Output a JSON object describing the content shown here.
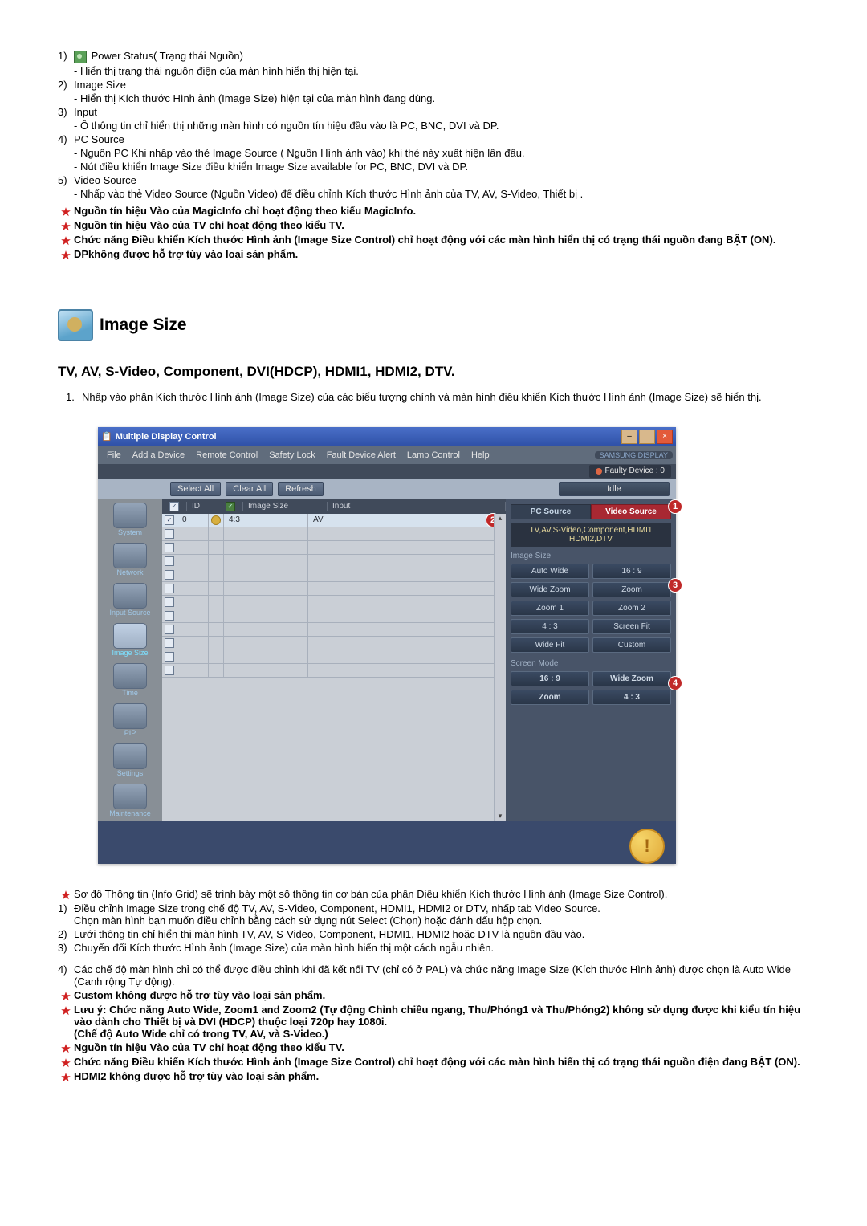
{
  "top_list": {
    "1": {
      "title": "Power Status( Trạng thái Nguồn)",
      "sub": [
        "Hiển thị trạng thái nguồn điện của màn hình hiển thị hiện tại."
      ]
    },
    "2": {
      "title": "Image Size",
      "sub": [
        "Hiển thị Kích thước Hình ảnh (Image Size) hiện tại của màn hình đang dùng."
      ]
    },
    "3": {
      "title": "Input",
      "sub": [
        "Ô thông tin chỉ hiển thị những màn hình có nguồn tín hiệu đầu vào là PC, BNC, DVI và DP."
      ]
    },
    "4": {
      "title": "PC Source",
      "sub": [
        "Nguồn PC Khi nhấp vào thẻ Image Source ( Nguồn Hình ảnh vào) khi thẻ này xuất hiện lần đầu.",
        "Nút điều khiển Image Size điều khiển Image Size available for PC, BNC, DVI và DP."
      ]
    },
    "5": {
      "title": "Video Source",
      "sub": [
        "Nhấp vào thẻ Video Source (Nguồn Video) để điều chỉnh Kích thước Hình ảnh của TV, AV, S-Video, Thiết bị ."
      ]
    }
  },
  "top_notes": [
    "Nguồn tín hiệu Vào của MagicInfo chỉ hoạt động theo kiểu MagicInfo.",
    "Nguồn tín hiệu Vào của TV chỉ hoạt động theo kiểu TV.",
    "Chức năng Điều khiển Kích thước Hình ảnh (Image Size Control) chỉ hoạt động với các màn hình hiển thị có trạng thái nguồn đang BẬT (ON).",
    "DPkhông được hỗ trợ tùy vào loại sản phẩm."
  ],
  "section": {
    "title": "Image Size",
    "subtitle": "TV, AV, S-Video, Component, DVI(HDCP), HDMI1, HDMI2, DTV.",
    "desc_num": "1.",
    "desc": "Nhấp vào phần Kích thước Hình ảnh (Image Size) của các biểu tượng chính và màn hình điều khiển Kích thước Hình ảnh (Image Size) sẽ hiển thị."
  },
  "app": {
    "title": "Multiple Display Control",
    "menu": [
      "File",
      "Add a Device",
      "Remote Control",
      "Safety Lock",
      "Fault Device Alert",
      "Lamp Control",
      "Help"
    ],
    "brand": "SAMSUNG DISPLAY",
    "faulty": "Faulty Device : 0",
    "toolbar": {
      "select_all": "Select All",
      "clear_all": "Clear All",
      "refresh": "Refresh",
      "idle": "Idle"
    },
    "sidebar": [
      "System",
      "Network",
      "Input Source",
      "Image Size",
      "Time",
      "PIP",
      "Settings",
      "Maintenance"
    ],
    "grid": {
      "headers": {
        "id": "ID",
        "image_size": "Image Size",
        "input": "Input"
      },
      "row0": {
        "id": "0",
        "image_size": "4:3",
        "input": "AV"
      }
    },
    "right": {
      "pc_tab": "PC Source",
      "video_tab": "Video Source",
      "info": "TV,AV,S-Video,Component,HDMI1\nHDMI2,DTV",
      "g1_label": "Image Size",
      "g1": [
        "Auto Wide",
        "16 : 9",
        "Wide Zoom",
        "Zoom",
        "Zoom 1",
        "Zoom 2",
        "4 : 3",
        "Screen Fit",
        "Wide Fit",
        "Custom"
      ],
      "g2_label": "Screen Mode",
      "g2": [
        "16 : 9",
        "Wide Zoom",
        "Zoom",
        "4 : 3"
      ]
    }
  },
  "footer_star0": "Sơ đồ Thông tin (Info Grid) sẽ trình bày một số thông tin cơ bản của phần Điều khiển Kích thước Hình ảnh (Image Size Control).",
  "footer_list": {
    "1": {
      "a": "Điều chỉnh Image Size trong chế độ TV, AV, S-Video, Component, HDMI1, HDMI2 or DTV, nhấp tab Video Source.",
      "b": "Chọn màn hình bạn muốn điều chỉnh bằng cách sử dụng nút Select (Chọn) hoặc đánh dấu hộp chọn."
    },
    "2": "Lưới thông tin chỉ hiển thị màn hình TV, AV, S-Video, Component, HDMI1, HDMI2 hoặc DTV là nguồn đầu vào.",
    "3": "Chuyển đổi Kích thước Hình ảnh (Image Size) của màn hình hiển thị một cách ngẫu nhiên.",
    "4": "Các chế độ màn hình chỉ có thể được điều chỉnh khi đã kết nối TV (chỉ có ở PAL) và chức năng Image Size (Kích thước Hình ảnh) được chọn là Auto Wide (Canh rộng Tự động)."
  },
  "footer_notes": [
    "Custom không được hỗ trợ tùy vào loại sản phẩm.",
    "Lưu ý: Chức năng Auto Wide, Zoom1 and Zoom2 (Tự động Chỉnh chiều ngang, Thu/Phóng1 và Thu/Phóng2) không sử dụng được khi kiểu tín hiệu vào dành cho Thiết bị và DVI (HDCP) thuộc loại 720p hay 1080i.\n(Chế độ Auto Wide chỉ có trong TV, AV, và S-Video.)",
    "Nguồn tín hiệu Vào của TV chỉ hoạt động theo kiểu TV.",
    "Chức năng Điều khiển Kích thước Hình ảnh (Image Size Control) chỉ hoạt động với các màn hình hiển thị có trạng thái nguồn điện đang BẬT (ON).",
    "HDMI2 không được hỗ trợ tùy vào loại sản phẩm."
  ]
}
